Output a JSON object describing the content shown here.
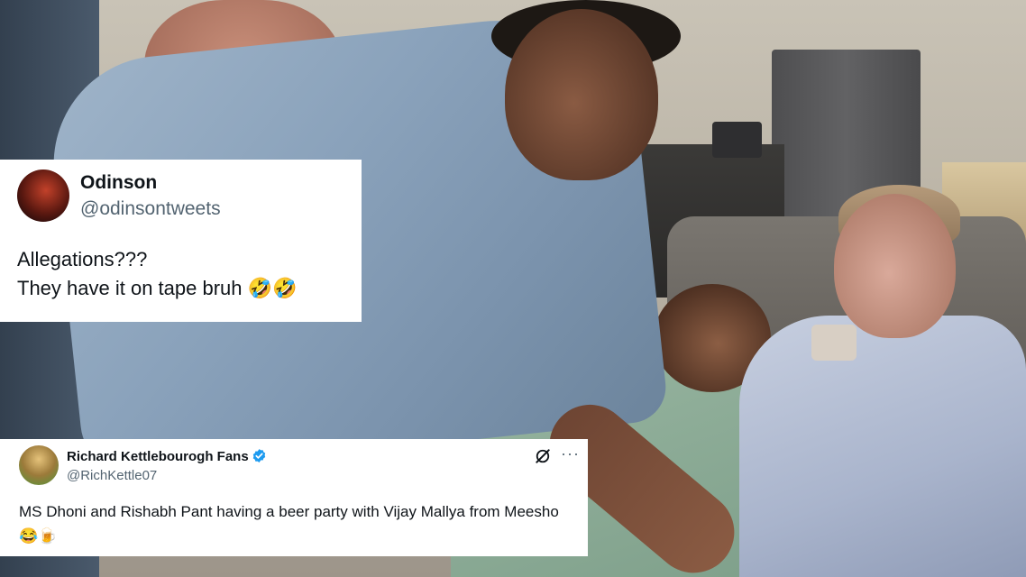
{
  "tweets": [
    {
      "name": "Odinson",
      "handle": "@odinsontweets",
      "text_line1": "Allegations???",
      "text_line2": "They have it on tape bruh 🤣🤣"
    },
    {
      "name": "Richard Kettlebourogh Fans",
      "verified": true,
      "handle": "@RichKettle07",
      "more_label": "···",
      "text": "MS Dhoni and Rishabh Pant having a beer party with Vijay Mallya from Meesho 😂🍺"
    }
  ],
  "colors": {
    "text_primary": "#0f1419",
    "text_secondary": "#536471",
    "verified_badge": "#1d9bf0"
  }
}
